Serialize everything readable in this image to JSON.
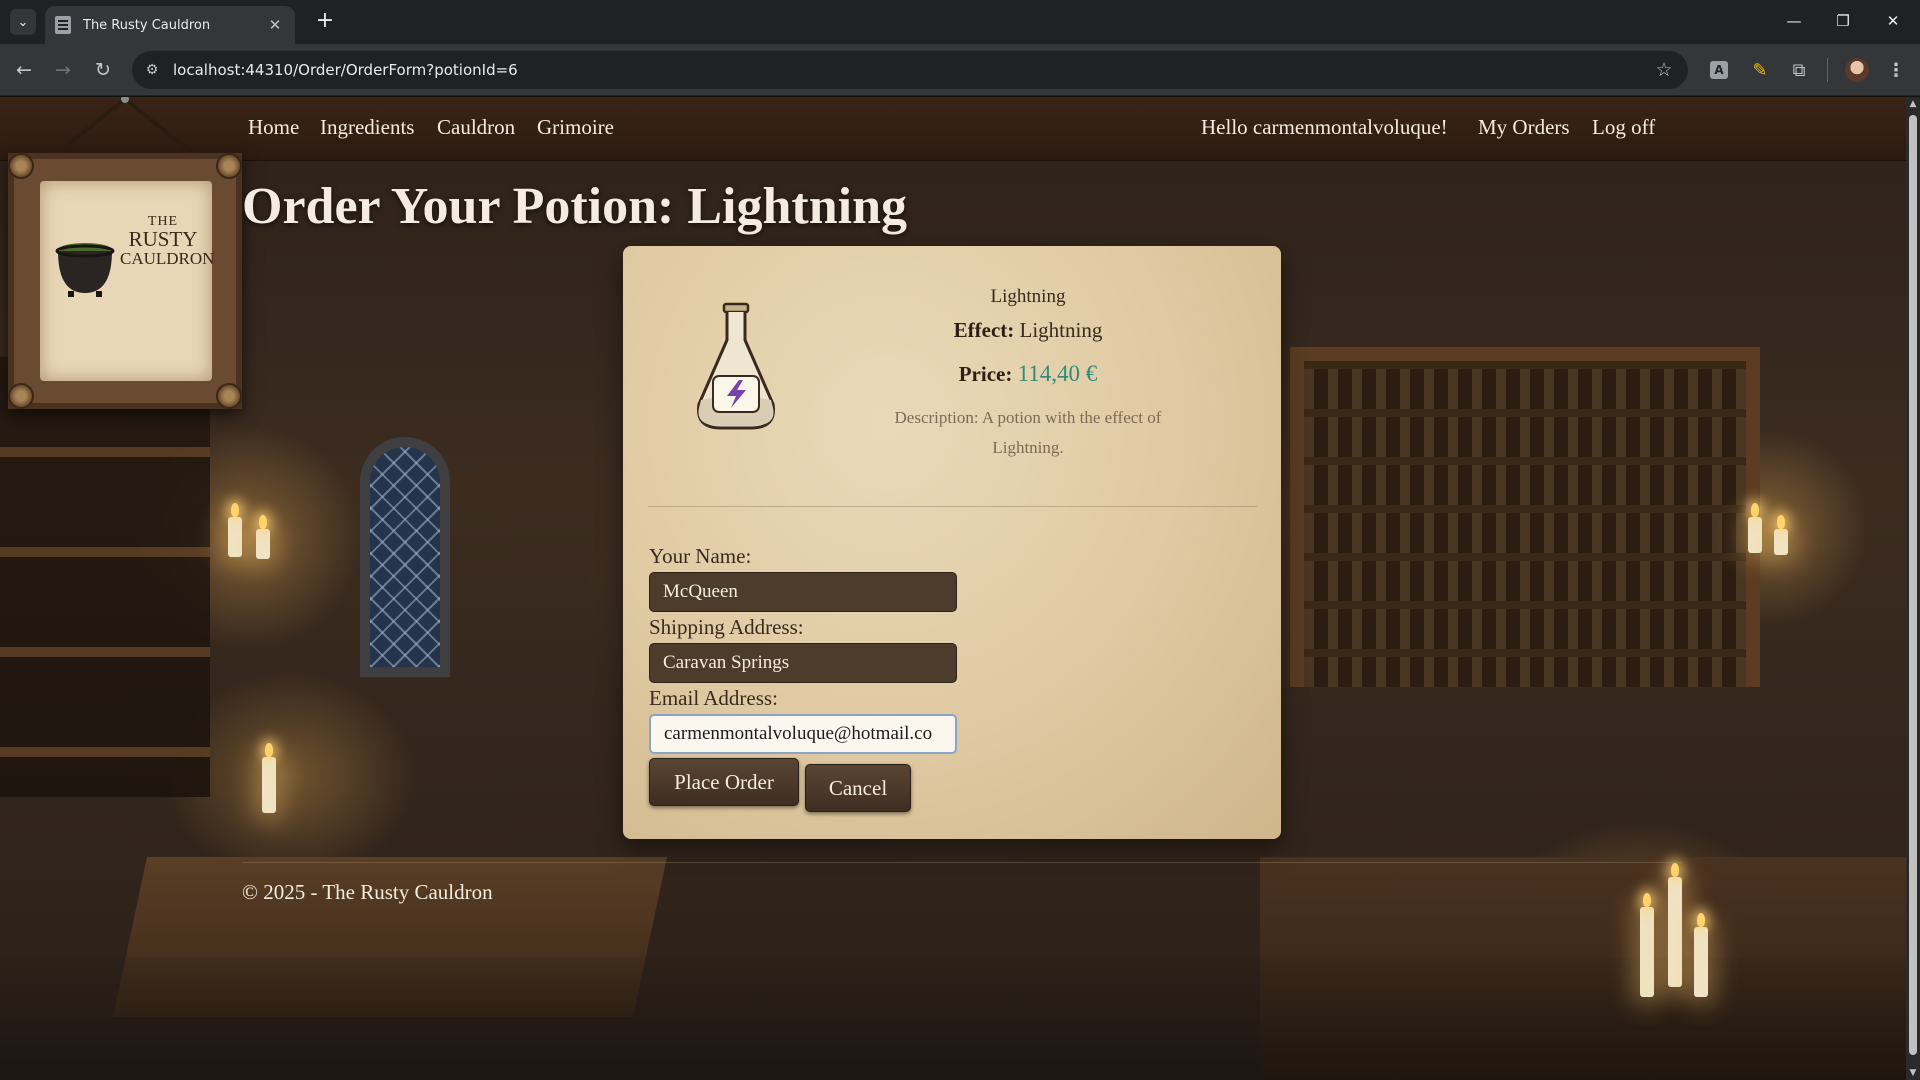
{
  "browser": {
    "tab_title": "The Rusty Cauldron",
    "url": "localhost:44310/Order/OrderForm?potionId=6",
    "icons": {
      "tab_list": "chevron-down-icon",
      "new_tab": "plus-icon",
      "back": "arrow-left-icon",
      "forward": "arrow-right-icon",
      "reload": "reload-icon",
      "site_info": "tune-icon",
      "bookmark": "star-icon",
      "menu": "vertical-dots-icon"
    }
  },
  "nav": {
    "left": [
      "Home",
      "Ingredients",
      "Cauldron",
      "Grimoire"
    ],
    "greeting": "Hello carmenmontalvoluque!",
    "my_orders": "My Orders",
    "log_off": "Log off"
  },
  "sign": {
    "line1": "THE",
    "line2": "RUSTY",
    "line3": "CAULDRON"
  },
  "page": {
    "title": "Order Your Potion: Lightning"
  },
  "potion": {
    "name": "Lightning",
    "effect_label": "Effect:",
    "effect": "Lightning",
    "price_label": "Price:",
    "price": "114,40 €",
    "description": "Description: A potion with the effect of Lightning."
  },
  "form": {
    "name_label": "Your Name:",
    "name_value": "McQueen",
    "address_label": "Shipping Address:",
    "address_value": "Caravan Springs",
    "email_label": "Email Address:",
    "email_value": "carmenmontalvoluque@hotmail.co",
    "place_order": "Place Order",
    "cancel": "Cancel"
  },
  "footer": {
    "text": "© 2025 - The Rusty Cauldron"
  },
  "colors": {
    "price": "#2f8c79",
    "nav_bg": "#3c2416",
    "card_bg": "#e2cfaa",
    "button_bg": "#4a382a"
  }
}
